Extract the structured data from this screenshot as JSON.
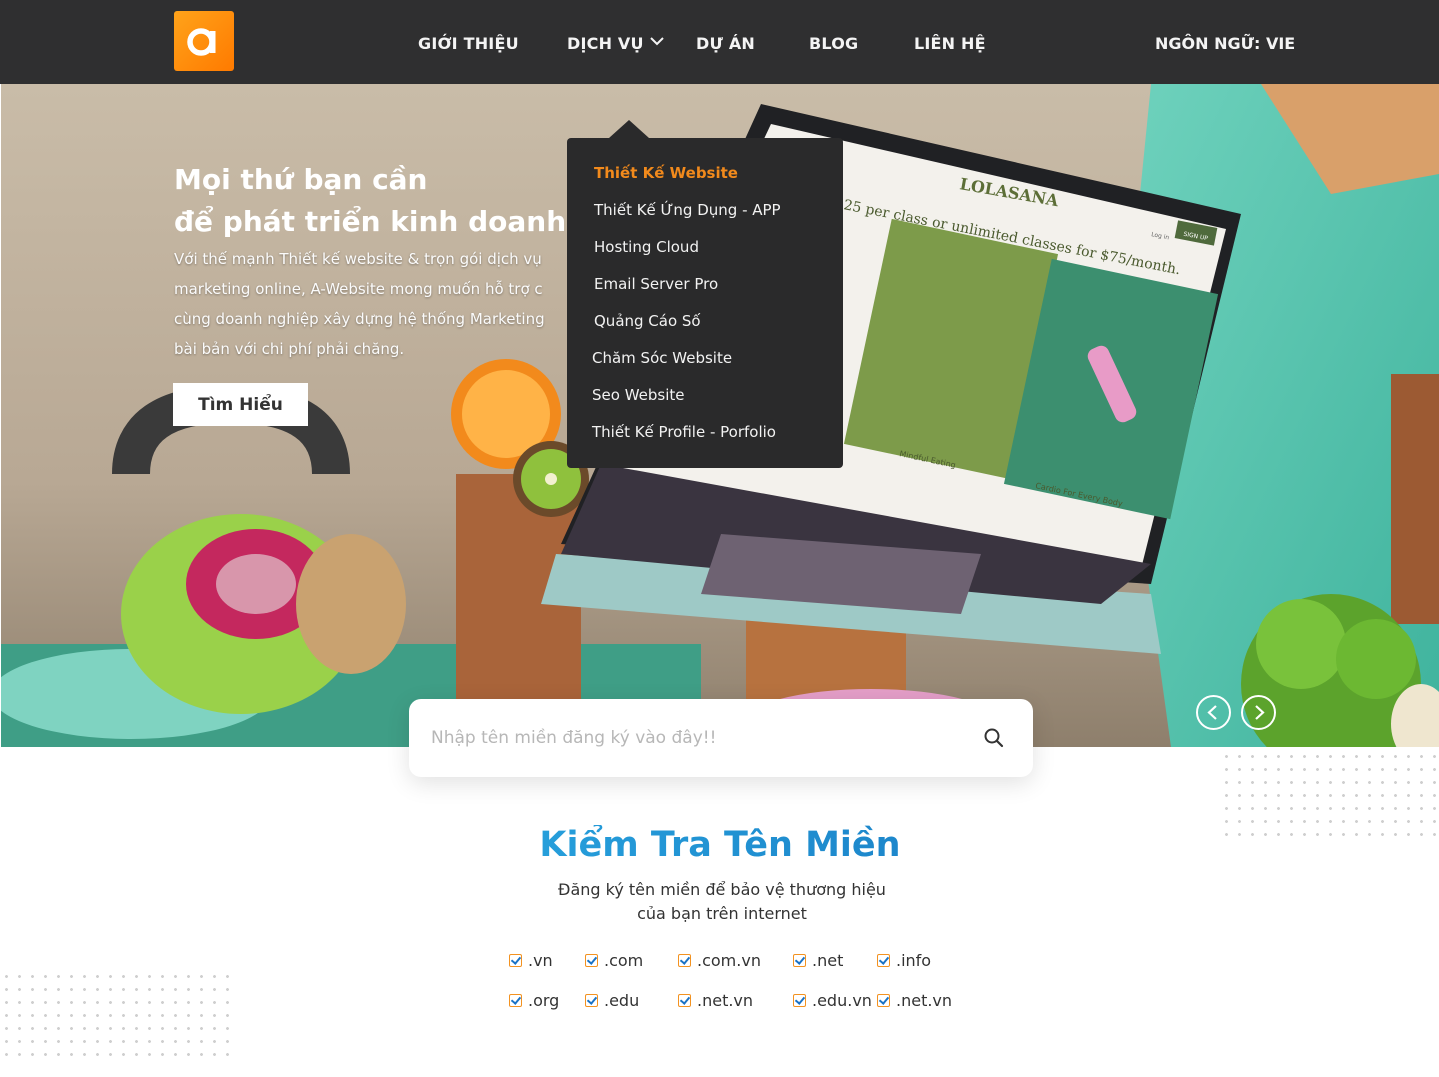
{
  "header": {
    "logo_icon": "a-letter-logo-icon",
    "nav": [
      "GIỚI THIỆU",
      "DỊCH VỤ",
      "DỰ ÁN",
      "BLOG",
      "LIÊN HỆ"
    ],
    "language": "NGÔN NGỮ: VIE"
  },
  "dropdown": {
    "items": [
      "Thiết Kế Website",
      "Thiết Kế Ứng Dụng - APP",
      "Hosting Cloud",
      "Email Server Pro",
      "Quảng Cáo Số",
      "Chăm Sóc Website",
      "Seo Website",
      "Thiết Kế Profile - Porfolio"
    ],
    "active_color": "#f28a1c"
  },
  "hero": {
    "title_line1": "Mọi thứ bạn cần",
    "title_line2": "để phát triển kinh doanh",
    "text_lines": [
      "Với thế mạnh Thiết kế website & trọn gói dịch vụ",
      "marketing online, A-Website mong muốn hỗ trợ c",
      "cùng doanh nghiệp xây dựng hệ thống Marketing",
      "bài bản với chi phí phải chăng."
    ],
    "button": "Tìm Hiểu",
    "laptop_brand": "LOLASANA",
    "laptop_headline": "25 per class or unlimited classes for $75/month.",
    "laptop_caption1": "Mindful Eating",
    "laptop_caption2": "Cardio For Every Body",
    "laptop_login": "Log in",
    "laptop_signup": "SIGN UP"
  },
  "search": {
    "placeholder": "Nhập tên miền đăng ký vào đây!!",
    "icon": "search-icon"
  },
  "domain_section": {
    "title": "Kiểm Tra Tên Miền",
    "subtitle_line1": "Đăng ký tên miền để bảo vệ thương hiệu",
    "subtitle_line2": "của bạn trên internet",
    "tlds": [
      ".vn",
      ".com",
      ".com.vn",
      ".net",
      ".info",
      ".org",
      ".edu",
      ".net.vn",
      ".edu.vn",
      ".net.vn"
    ]
  },
  "colors": {
    "header_bg": "#2f2f30",
    "accent_orange": "#f39220",
    "title_blue": "#1a7fc6"
  }
}
